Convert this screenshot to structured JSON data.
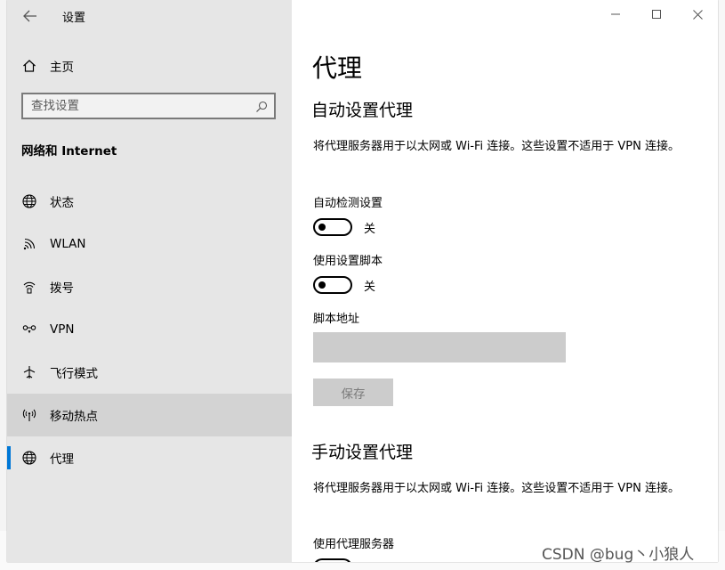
{
  "window": {
    "title": "设置",
    "back_icon": "arrow-left-icon",
    "controls": [
      "minimize-icon",
      "maximize-icon",
      "close-icon"
    ]
  },
  "sidebar": {
    "home_label": "主页",
    "search_placeholder": "查找设置",
    "section_title": "网络和 Internet",
    "items": [
      {
        "label": "状态",
        "icon": "globe-icon"
      },
      {
        "label": "WLAN",
        "icon": "wifi-icon"
      },
      {
        "label": "拨号",
        "icon": "dialup-icon"
      },
      {
        "label": "VPN",
        "icon": "vpn-icon"
      },
      {
        "label": "飞行模式",
        "icon": "airplane-icon"
      },
      {
        "label": "移动热点",
        "icon": "hotspot-icon"
      },
      {
        "label": "代理",
        "icon": "globe-icon"
      }
    ],
    "selected": "代理",
    "hovered": "移动热点",
    "accent_color": "#0078d7"
  },
  "main": {
    "page_title": "代理",
    "auto": {
      "heading": "自动设置代理",
      "description": "将代理服务器用于以太网或 Wi-Fi 连接。这些设置不适用于 VPN 连接。",
      "detect_label": "自动检测设置",
      "detect_state": "关",
      "script_label": "使用设置脚本",
      "script_state": "关",
      "address_label": "脚本地址",
      "address_value": "",
      "save_label": "保存"
    },
    "manual": {
      "heading": "手动设置代理",
      "description": "将代理服务器用于以太网或 Wi-Fi 连接。这些设置不适用于 VPN 连接。",
      "use_proxy_label": "使用代理服务器"
    }
  },
  "watermark": "CSDN @bug丶小狼人"
}
